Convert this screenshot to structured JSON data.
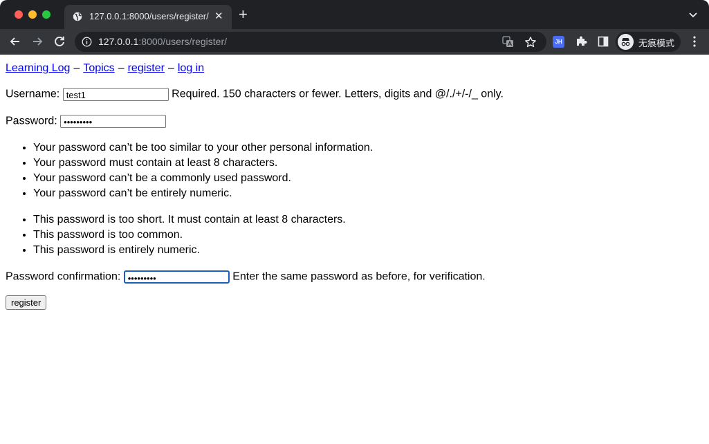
{
  "tab": {
    "title": "127.0.0.1:8000/users/register/",
    "close": "✕",
    "new_tab": "+"
  },
  "address_bar": {
    "host": "127.0.0.1",
    "rest": ":8000/users/register/"
  },
  "extensions": {
    "jh_label": "JH"
  },
  "profile": {
    "label": "无痕模式"
  },
  "nav": {
    "learning_log": "Learning Log",
    "sep1": "–",
    "topics": "Topics",
    "sep2": "–",
    "register": "register",
    "sep3": "–",
    "login": "log in"
  },
  "form": {
    "username_label": "Username:",
    "username_value": "test1",
    "username_help": "Required. 150 characters or fewer. Letters, digits and @/./+/-/_ only.",
    "password_label": "Password:",
    "password_value": "•••••••••",
    "password_help": [
      "Your password can’t be too similar to your other personal information.",
      "Your password must contain at least 8 characters.",
      "Your password can’t be a commonly used password.",
      "Your password can’t be entirely numeric."
    ],
    "password_errors": [
      "This password is too short. It must contain at least 8 characters.",
      "This password is too common.",
      "This password is entirely numeric."
    ],
    "confirm_label": "Password confirmation:",
    "confirm_value": "•••••••••",
    "confirm_help": "Enter the same password as before, for verification.",
    "submit_label": "register"
  }
}
